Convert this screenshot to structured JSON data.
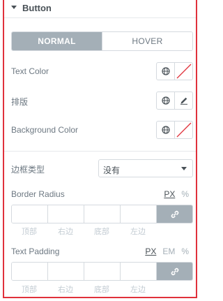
{
  "section": {
    "title": "Button",
    "icon": "caret-down-icon"
  },
  "state_tabs": [
    {
      "label": "NORMAL",
      "active": true
    },
    {
      "label": "HOVER",
      "active": false
    }
  ],
  "controls": {
    "text_color": {
      "label": "Text Color",
      "icons": [
        "globe-icon",
        "empty-color-swatch"
      ]
    },
    "typography": {
      "label": "排版",
      "icons": [
        "globe-icon",
        "pencil-icon"
      ]
    },
    "background_color": {
      "label": "Background Color",
      "icons": [
        "globe-icon",
        "empty-color-swatch"
      ]
    }
  },
  "border_type": {
    "label": "边框类型",
    "value": "没有"
  },
  "border_radius": {
    "label": "Border Radius",
    "units": [
      {
        "label": "PX",
        "active": true
      },
      {
        "label": "%",
        "active": false
      }
    ],
    "fields": [
      {
        "label": "顶部",
        "value": ""
      },
      {
        "label": "右边",
        "value": ""
      },
      {
        "label": "底部",
        "value": ""
      },
      {
        "label": "左边",
        "value": ""
      }
    ],
    "link_icon": "link-icon"
  },
  "text_padding": {
    "label": "Text Padding",
    "units": [
      {
        "label": "PX",
        "active": true
      },
      {
        "label": "EM",
        "active": false
      },
      {
        "label": "%",
        "active": false
      }
    ],
    "fields": [
      {
        "label": "顶部",
        "value": ""
      },
      {
        "label": "右边",
        "value": ""
      },
      {
        "label": "底部",
        "value": ""
      },
      {
        "label": "左边",
        "value": ""
      }
    ],
    "link_icon": "link-icon"
  },
  "colors": {
    "accent_border": "#e0313b",
    "tab_active_bg": "#a4afb7",
    "swatch_slash": "#e0313b"
  }
}
